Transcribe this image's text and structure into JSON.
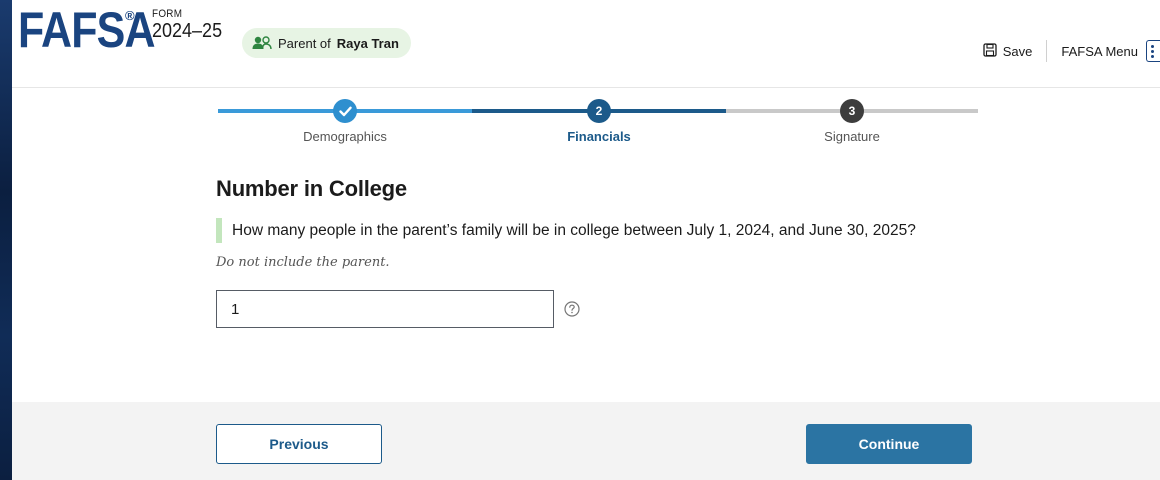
{
  "header": {
    "logo": "FAFSA",
    "logo_mark": "®",
    "form_label": "FORM",
    "form_year": "2024–25",
    "role": {
      "prefix": "Parent of ",
      "name": "Raya Tran",
      "icon": "people-icon"
    },
    "save_label": "Save",
    "save_icon": "save-icon",
    "menu_label": "FAFSA Menu"
  },
  "stepper": {
    "steps": [
      {
        "number": "✓",
        "label": "Demographics",
        "state": "complete"
      },
      {
        "number": "2",
        "label": "Financials",
        "state": "current"
      },
      {
        "number": "3",
        "label": "Signature",
        "state": "upcoming"
      }
    ]
  },
  "main": {
    "title": "Number in College",
    "question": "How many people in the parent’s family will be in college between July 1, 2024, and June 30, 2025?",
    "hint": "Do not include the parent.",
    "input_value": "1",
    "help_icon": "question-circle-icon"
  },
  "footer": {
    "previous_label": "Previous",
    "continue_label": "Continue"
  },
  "colors": {
    "brand": "#1a4480",
    "step_complete": "#2e8fcf",
    "step_current": "#1c5a8a",
    "continue_button": "#2b74a3",
    "role_pill": "#e7f4e4"
  }
}
